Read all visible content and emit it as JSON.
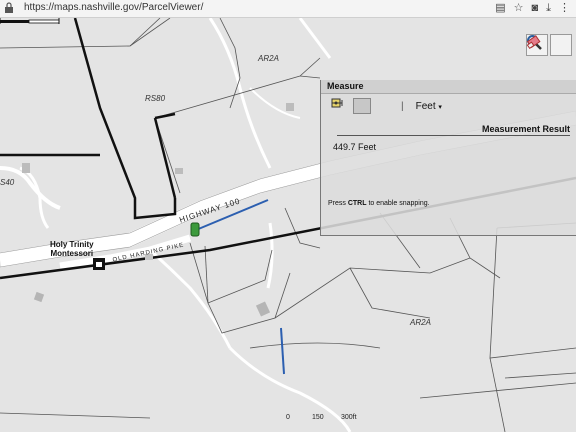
{
  "browser": {
    "url": "https://maps.nashville.gov/ParcelViewer/"
  },
  "map": {
    "zone_labels": [
      "AR2A",
      "RS80",
      "AR2A",
      "S40"
    ],
    "road_highway": "HIGHWAY 100",
    "road_local": "OLD HARDING PIKE",
    "place_label_line1": "Holy Trinity",
    "place_label_line2": "Montessori",
    "scale": {
      "zero": "0",
      "mid": "150",
      "end": "300ft"
    }
  },
  "toolbar": {
    "search_icon": "magnifier-icon",
    "eraser_icon": "eraser-icon"
  },
  "measure_panel": {
    "title": "Measure",
    "unit_label": "Feet",
    "result_header": "Measurement Result",
    "result_value": "449.7 Feet",
    "hint_prefix": "Press ",
    "hint_key": "CTRL",
    "hint_suffix": " to enable snapping."
  }
}
